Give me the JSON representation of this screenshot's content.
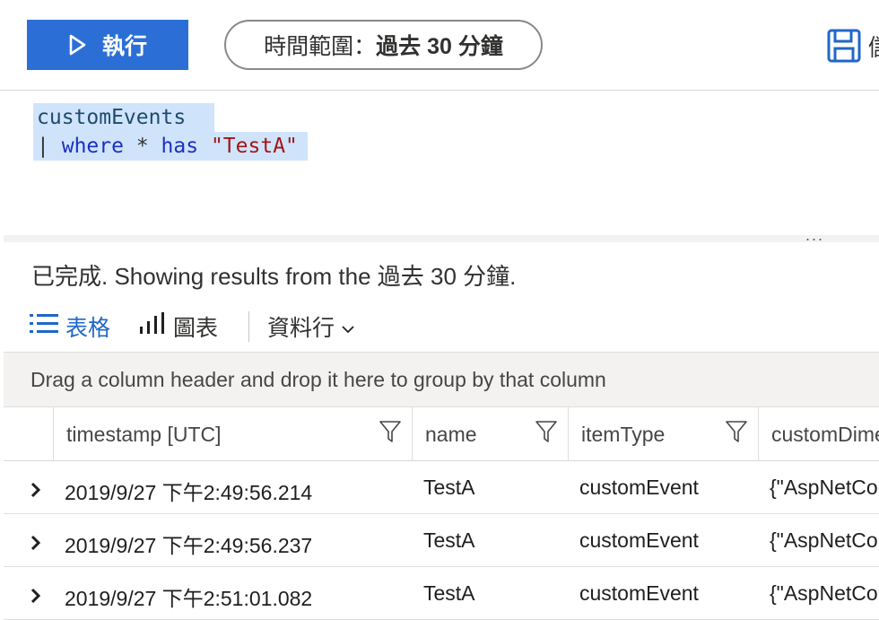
{
  "toolbar": {
    "run_label": "執行",
    "time_range_label": "時間範圍：",
    "time_range_value": "過去 30 分鐘",
    "save_label": "儲"
  },
  "editor": {
    "line1": "customEvents",
    "pipe": "|",
    "where_kw": "where",
    "star": "*",
    "has_kw": "has",
    "string": "\"TestA\"",
    "more": "..."
  },
  "results": {
    "status": "已完成. Showing results from the 過去 30 分鐘.",
    "tabs": {
      "table": "表格",
      "chart": "圖表",
      "columns": "資料行"
    },
    "group_hint": "Drag a column header and drop it here to group by that column",
    "columns": [
      "timestamp [UTC]",
      "name",
      "itemType",
      "customDime"
    ],
    "rows": [
      {
        "timestamp": "2019/9/27 下午2:49:56.214",
        "name": "TestA",
        "itemType": "customEvent",
        "customDimensions": "{\"AspNetCo"
      },
      {
        "timestamp": "2019/9/27 下午2:49:56.237",
        "name": "TestA",
        "itemType": "customEvent",
        "customDimensions": "{\"AspNetCo"
      },
      {
        "timestamp": "2019/9/27 下午2:51:01.082",
        "name": "TestA",
        "itemType": "customEvent",
        "customDimensions": "{\"AspNetCo"
      }
    ]
  },
  "colors": {
    "accent": "#2b6fd6",
    "tab_active": "#1f67c9",
    "code_highlight": "#cfe4fb"
  }
}
